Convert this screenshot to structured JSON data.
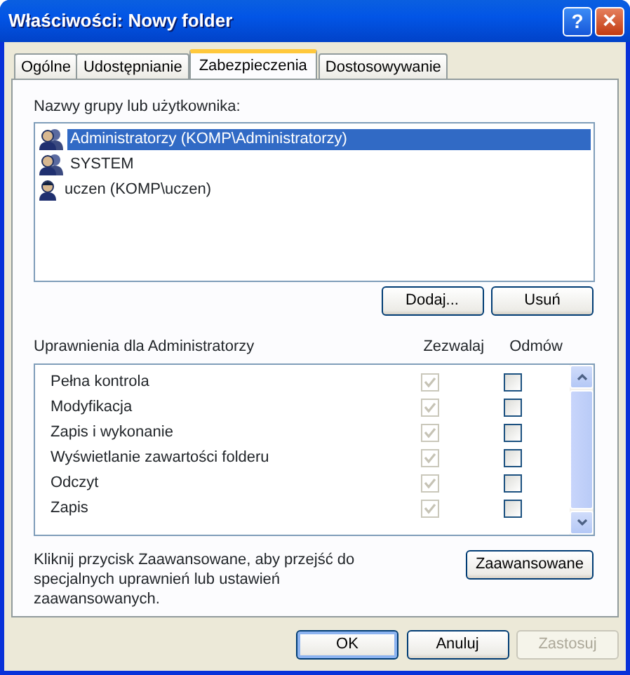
{
  "window": {
    "title": "Właściwości: Nowy folder",
    "help_button": "?",
    "close_button": "×"
  },
  "tabs": [
    {
      "label": "Ogólne",
      "selected": false
    },
    {
      "label": "Udostępnianie",
      "selected": false
    },
    {
      "label": "Zabezpieczenia",
      "selected": true
    },
    {
      "label": "Dostosowywanie",
      "selected": false
    }
  ],
  "users_label": "Nazwy grupy lub użytkownika:",
  "users": [
    {
      "name": "Administratorzy (KOMP\\Administratorzy)",
      "kind": "group",
      "selected": true
    },
    {
      "name": "SYSTEM",
      "kind": "group",
      "selected": false
    },
    {
      "name": "uczen (KOMP\\uczen)",
      "kind": "user",
      "selected": false
    }
  ],
  "user_buttons": [
    "Dodaj...",
    "Usuń"
  ],
  "permissions_label": "Uprawnienia dla Administratorzy",
  "permission_columns": [
    "Zezwalaj",
    "Odmów"
  ],
  "permissions": [
    {
      "name": "Pełna kontrola",
      "allow": {
        "checked": true,
        "disabled": true
      },
      "deny": {
        "checked": false,
        "disabled": false
      }
    },
    {
      "name": "Modyfikacja",
      "allow": {
        "checked": true,
        "disabled": true
      },
      "deny": {
        "checked": false,
        "disabled": false
      }
    },
    {
      "name": "Zapis i wykonanie",
      "allow": {
        "checked": true,
        "disabled": true
      },
      "deny": {
        "checked": false,
        "disabled": false
      }
    },
    {
      "name": "Wyświetlanie zawartości folderu",
      "allow": {
        "checked": true,
        "disabled": true
      },
      "deny": {
        "checked": false,
        "disabled": false
      }
    },
    {
      "name": "Odczyt",
      "allow": {
        "checked": true,
        "disabled": true
      },
      "deny": {
        "checked": false,
        "disabled": false
      }
    },
    {
      "name": "Zapis",
      "allow": {
        "checked": true,
        "disabled": true
      },
      "deny": {
        "checked": false,
        "disabled": false
      }
    }
  ],
  "advanced_text": "Kliknij przycisk Zaawansowane, aby przejść do specjalnych uprawnień lub ustawień zaawansowanych.",
  "advanced_button": "Zaawansowane",
  "dialog_buttons": [
    {
      "label": "OK",
      "disabled": false,
      "default": true
    },
    {
      "label": "Anuluj",
      "disabled": false,
      "default": false
    },
    {
      "label": "Zastosuj",
      "disabled": true,
      "default": false
    }
  ]
}
